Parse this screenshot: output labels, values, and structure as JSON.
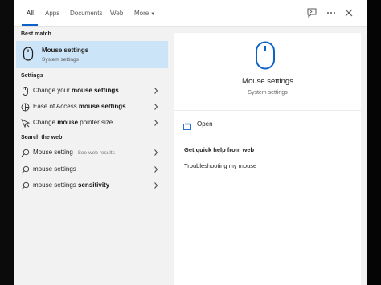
{
  "tabs": [
    {
      "label": "All"
    },
    {
      "label": "Apps"
    },
    {
      "label": "Documents"
    },
    {
      "label": "Web"
    },
    {
      "label": "More"
    }
  ],
  "left": {
    "best_match_header": "Best match",
    "best_match": {
      "title": "Mouse settings",
      "subtitle": "System settings"
    },
    "settings_header": "Settings",
    "settings_items": [
      {
        "prefix": "Change your ",
        "bold": "mouse settings",
        "suffix": ""
      },
      {
        "prefix": "Ease of Access ",
        "bold": "mouse settings",
        "suffix": ""
      },
      {
        "prefix": "Change ",
        "bold": "mouse",
        "suffix": " pointer size"
      }
    ],
    "web_header": "Search the web",
    "web_items": [
      {
        "prefix": "Mouse setting",
        "bold": "",
        "suffix": " - See web results"
      },
      {
        "prefix": "mouse settings",
        "bold": "",
        "suffix": ""
      },
      {
        "prefix": "mouse settings ",
        "bold": "sensitivity",
        "suffix": ""
      }
    ]
  },
  "right": {
    "title": "Mouse settings",
    "subtitle": "System settings",
    "open_label": "Open",
    "help_header": "Get quick help from web",
    "help_link": "Troubleshooting my mouse"
  },
  "colors": {
    "accent": "#0a62c8",
    "selected": "#cce4f7"
  },
  "icons": {
    "feedback": "feedback-icon",
    "more": "ellipsis-icon",
    "close": "close-icon",
    "mouse": "mouse-icon",
    "search": "search-icon",
    "chevron": "chevron-right-icon"
  }
}
